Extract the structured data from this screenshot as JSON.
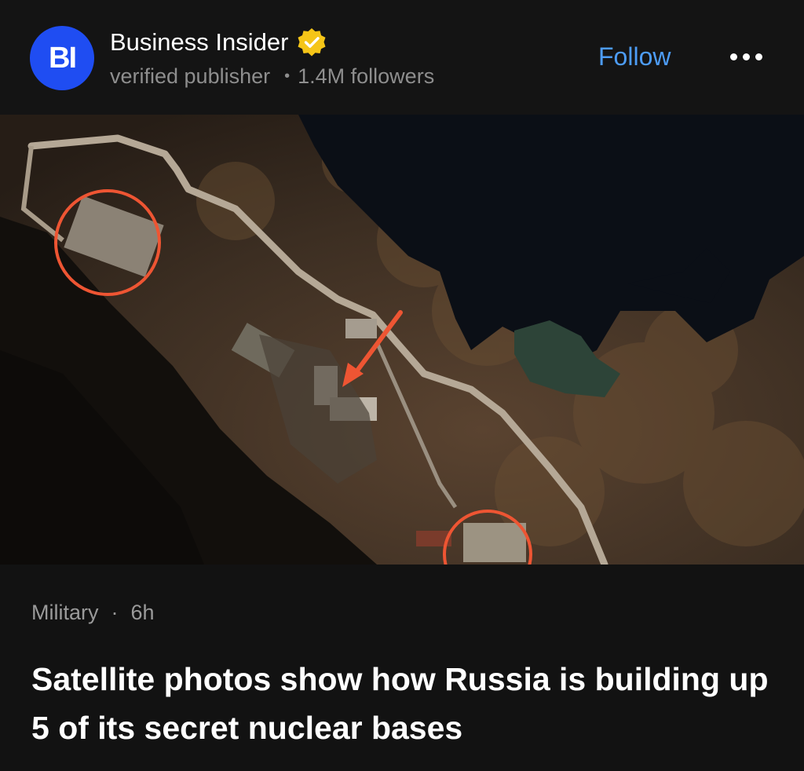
{
  "publisher": {
    "initials": "BI",
    "name": "Business Insider",
    "status": "verified publisher",
    "followers": "1.4M followers",
    "follow_label": "Follow"
  },
  "article": {
    "category": "Military",
    "age": "6h",
    "headline": "Satellite photos show how Russia is building up 5 of its secret nuclear bases"
  },
  "colors": {
    "avatar_bg": "#1f4df2",
    "verified_badge": "#f5c518",
    "follow": "#4d9cf6",
    "annotation": "#ee5533"
  },
  "icons": {
    "verified": "verified-badge-icon",
    "more": "more-dots-icon"
  }
}
